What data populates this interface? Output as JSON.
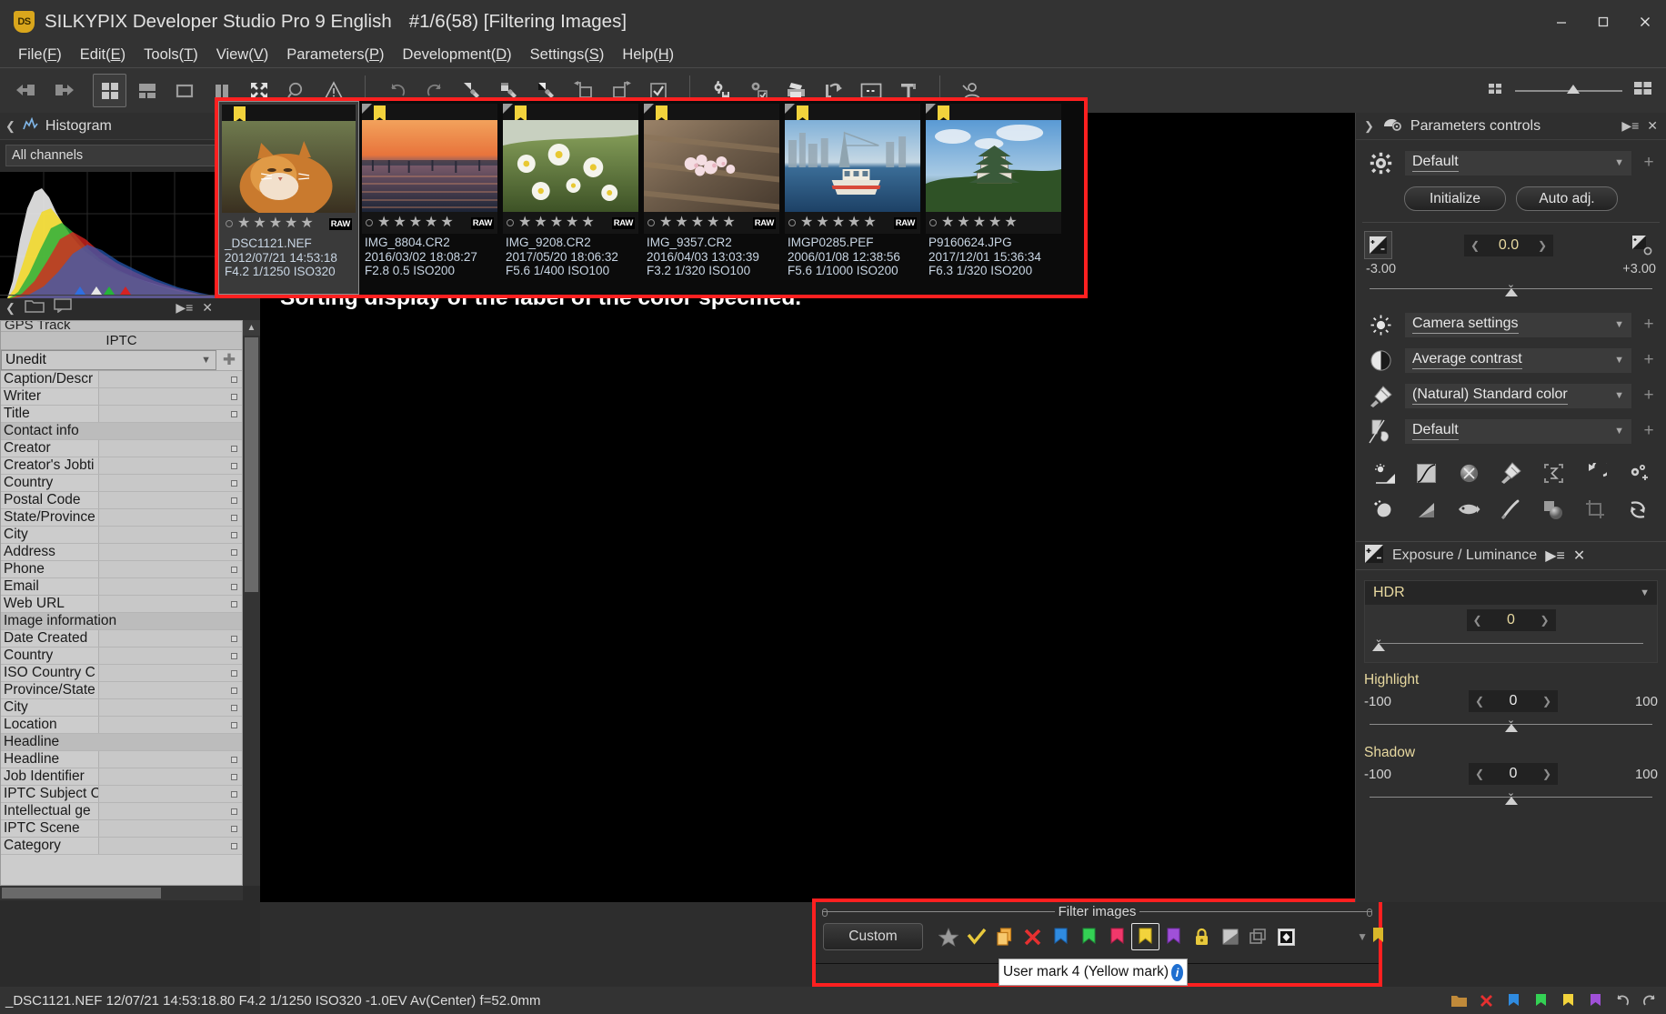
{
  "window": {
    "app_title": "SILKYPIX Developer Studio Pro 9 English",
    "doc_status": "#1/6(58) [Filtering Images]",
    "logo_text": "DS",
    "minimize": "minimize-icon",
    "maximize": "maximize-icon",
    "close": "close-icon"
  },
  "menubar": [
    {
      "label": "File(F)",
      "text": "File(",
      "key": "F",
      "tail": ")"
    },
    {
      "label": "Edit(E)",
      "text": "Edit(",
      "key": "E",
      "tail": ")"
    },
    {
      "label": "Tools(T)",
      "text": "Tools(",
      "key": "T",
      "tail": ")"
    },
    {
      "label": "View(V)",
      "text": "View(",
      "key": "V",
      "tail": ")"
    },
    {
      "label": "Parameters(P)",
      "text": "Parameters(",
      "key": "P",
      "tail": ")"
    },
    {
      "label": "Development(D)",
      "text": "Development(",
      "key": "D",
      "tail": ")"
    },
    {
      "label": "Settings(S)",
      "text": "Settings(",
      "key": "S",
      "tail": ")"
    },
    {
      "label": "Help(H)",
      "text": "Help(",
      "key": "H",
      "tail": ")"
    }
  ],
  "toolbar": {
    "group1": [
      {
        "name": "previous-image-icon"
      },
      {
        "name": "next-image-icon"
      }
    ],
    "group2": [
      {
        "name": "thumbnail-grid-view-icon",
        "selected": true
      },
      {
        "name": "combination-view-icon",
        "selected": false
      },
      {
        "name": "single-image-view-icon",
        "selected": false
      },
      {
        "name": "two-pane-view-icon",
        "selected": false
      },
      {
        "name": "fit-to-screen-icon",
        "selected": false
      },
      {
        "name": "magnifier-icon",
        "selected": false
      },
      {
        "name": "warning-icon",
        "selected": false
      }
    ],
    "group3": [
      {
        "name": "undo-icon"
      },
      {
        "name": "redo-icon"
      },
      {
        "name": "white-balance-picker-icon"
      },
      {
        "name": "gray-balance-picker-icon"
      },
      {
        "name": "black-white-point-picker-icon"
      },
      {
        "name": "rotate-left-icon"
      },
      {
        "name": "rotate-right-icon"
      },
      {
        "name": "checkmark-box-icon"
      }
    ],
    "group4": [
      {
        "name": "develop-settings-icon"
      },
      {
        "name": "batch-develop-icon"
      },
      {
        "name": "print-icon"
      },
      {
        "name": "export-icon"
      },
      {
        "name": "slideshow-icon"
      },
      {
        "name": "ruler-icon"
      }
    ],
    "group5": [
      {
        "name": "user-profile-icon"
      }
    ],
    "zoom": {
      "small_icon": "small-thumbnail-icon",
      "large_icon": "large-thumbnail-icon",
      "value_pct": 48
    }
  },
  "histogram_panel": {
    "title": "Histogram",
    "icon": "histogram-icon",
    "collapse_icon": "chevron-left-icon",
    "menu_icon": "panel-menu-icon",
    "close_icon": "close-icon",
    "channel_select": "All channels",
    "markers": [
      {
        "name": "blue-marker",
        "color": "#2f6fe0",
        "x_pct": 36
      },
      {
        "name": "white-marker",
        "color": "#e6e6e6",
        "x_pct": 45
      },
      {
        "name": "green-marker",
        "color": "#25b43a",
        "x_pct": 49
      },
      {
        "name": "red-marker",
        "color": "#d62222",
        "x_pct": 57
      }
    ],
    "tools": [
      {
        "name": "chevron-left-icon"
      },
      {
        "name": "folder-icon"
      },
      {
        "name": "comment-icon"
      },
      {
        "name": "panel-menu-icon"
      },
      {
        "name": "close-icon"
      }
    ]
  },
  "iptc_panel": {
    "clipped_top_label": "GPS Track",
    "title": "IPTC",
    "preset": "Unedit",
    "add_icon": "add-preset-icon",
    "rows": [
      {
        "label": "Caption/Descr",
        "value": "",
        "group": false
      },
      {
        "label": "Writer",
        "value": "",
        "group": false
      },
      {
        "label": "Title",
        "value": "",
        "group": false
      },
      {
        "label": "Contact info",
        "value": "",
        "group": true
      },
      {
        "label": "Creator",
        "value": "",
        "group": false
      },
      {
        "label": "Creator's Jobti",
        "value": "",
        "group": false
      },
      {
        "label": "Country",
        "value": "",
        "group": false
      },
      {
        "label": "Postal Code",
        "value": "",
        "group": false
      },
      {
        "label": "State/Province",
        "value": "",
        "group": false
      },
      {
        "label": "City",
        "value": "",
        "group": false
      },
      {
        "label": "Address",
        "value": "",
        "group": false
      },
      {
        "label": "Phone",
        "value": "",
        "group": false
      },
      {
        "label": "Email",
        "value": "",
        "group": false
      },
      {
        "label": "Web URL",
        "value": "",
        "group": false
      },
      {
        "label": "Image information",
        "value": "",
        "group": true
      },
      {
        "label": "Date Created",
        "value": "",
        "group": false
      },
      {
        "label": "Country",
        "value": "",
        "group": false
      },
      {
        "label": "ISO Country C",
        "value": "",
        "group": false
      },
      {
        "label": "Province/State",
        "value": "",
        "group": false
      },
      {
        "label": "City",
        "value": "",
        "group": false
      },
      {
        "label": "Location",
        "value": "",
        "group": false
      },
      {
        "label": "Headline",
        "value": "",
        "group": true
      },
      {
        "label": "Headline",
        "value": "",
        "group": false
      },
      {
        "label": "Job Identifier",
        "value": "",
        "group": false
      },
      {
        "label": "IPTC Subject C",
        "value": "",
        "group": false
      },
      {
        "label": "Intellectual ge",
        "value": "",
        "group": false
      },
      {
        "label": "IPTC Scene",
        "value": "",
        "group": false
      },
      {
        "label": "Category",
        "value": "",
        "group": false
      }
    ]
  },
  "filmstrip": {
    "highlight_color": "#ff2020",
    "thumbnails": [
      {
        "filename": "_DSC1121.NEF",
        "datetime": "2012/07/21 14:53:18",
        "exposure": "F4.2 1/1250 ISO320",
        "stars": 5,
        "format_badge": "RAW",
        "mark_color": "#f2d33c",
        "selected": true,
        "image": "cat-photo"
      },
      {
        "filename": "IMG_8804.CR2",
        "datetime": "2016/03/02 18:08:27",
        "exposure": "F2.8 0.5 ISO200",
        "stars": 5,
        "format_badge": "RAW",
        "mark_color": "#f2d33c",
        "selected": false,
        "image": "sunset-pier-photo"
      },
      {
        "filename": "IMG_9208.CR2",
        "datetime": "2017/05/20 18:06:32",
        "exposure": "F5.6 1/400 ISO100",
        "stars": 5,
        "format_badge": "RAW",
        "mark_color": "#f2d33c",
        "selected": false,
        "image": "daisies-photo"
      },
      {
        "filename": "IMG_9357.CR2",
        "datetime": "2016/04/03 13:03:39",
        "exposure": "F3.2 1/320 ISO100",
        "stars": 5,
        "format_badge": "RAW",
        "mark_color": "#f2d33c",
        "selected": false,
        "image": "cherry-blossom-photo"
      },
      {
        "filename": "IMGP0285.PEF",
        "datetime": "2006/01/08 12:38:56",
        "exposure": "F5.6 1/1000 ISO200",
        "stars": 5,
        "format_badge": "RAW",
        "mark_color": "#f2d33c",
        "selected": false,
        "image": "harbor-boat-photo"
      },
      {
        "filename": "P9160624.JPG",
        "datetime": "2017/12/01 15:36:34",
        "exposure": "F6.3 1/320 ISO200",
        "stars": 5,
        "format_badge": "",
        "mark_color": "#f2d33c",
        "selected": false,
        "image": "castle-photo"
      }
    ]
  },
  "center": {
    "message": "Sorting display of the label of the color specified."
  },
  "filter_images": {
    "legend": "Filter images",
    "highlight_color": "#ff2020",
    "custom_button": "Custom",
    "icons": [
      {
        "name": "star-rating-filter-icon",
        "color": "#9a9a9a",
        "selected": false
      },
      {
        "name": "checkmark-filter-icon",
        "color": "#e8c93c",
        "selected": false
      },
      {
        "name": "copy-filter-icon",
        "color": "#e8a23c",
        "selected": false
      },
      {
        "name": "reject-filter-icon",
        "color": "#e63030",
        "selected": false
      },
      {
        "name": "user-mark-1-blue-icon",
        "color": "#2f8be0",
        "selected": false
      },
      {
        "name": "user-mark-2-green-icon",
        "color": "#34d154",
        "selected": false
      },
      {
        "name": "user-mark-3-pink-icon",
        "color": "#f0386b",
        "selected": false
      },
      {
        "name": "user-mark-4-yellow-icon",
        "color": "#f2d33c",
        "selected": true
      },
      {
        "name": "user-mark-5-purple-icon",
        "color": "#a050d8",
        "selected": false
      },
      {
        "name": "lock-filter-icon",
        "color": "#e8c93c",
        "selected": false
      },
      {
        "name": "taper-filter-icon",
        "color": "#b8b8b8",
        "selected": false
      },
      {
        "name": "duplicate-filter-icon",
        "color": "#8a8a8a",
        "selected": false
      },
      {
        "name": "contrast-filter-icon",
        "color": "#e4e4e4",
        "selected": false
      }
    ],
    "dropdown_icon": "chevron-down-icon",
    "tooltip": {
      "text": "User mark 4 (Yellow mark)",
      "info_icon": "info-icon",
      "info_color": "#1f6fd0"
    }
  },
  "parameters_panel": {
    "title": "Parameters controls",
    "icon": "parameters-controls-icon",
    "expand_icon": "chevron-right-icon",
    "menu_icon": "panel-menu-icon",
    "close_icon": "close-icon",
    "preset": {
      "icon": "gear-icon",
      "value": "Default",
      "add_icon": "plus-icon"
    },
    "initialize_button": "Initialize",
    "auto_adj_button": "Auto adj.",
    "exposure_bias": {
      "icon": "exposure-compensation-icon",
      "value": "0.0",
      "min_label": "-3.00",
      "max_label": "+3.00",
      "detail_icon": "exposure-detail-icon",
      "knob_pct": 50
    },
    "rows": [
      {
        "icon": "white-balance-sun-icon",
        "value": "Camera settings",
        "add_icon": "plus-icon"
      },
      {
        "icon": "tone-contrast-icon",
        "value": "Average contrast",
        "add_icon": "plus-icon"
      },
      {
        "icon": "color-mode-icon",
        "value": "(Natural) Standard color",
        "add_icon": "plus-icon"
      },
      {
        "icon": "sharpness-brush-icon",
        "value": "Default",
        "add_icon": "plus-icon"
      }
    ],
    "tool_grid": [
      [
        {
          "name": "exposure-luminance-tool-icon"
        },
        {
          "name": "tone-curve-tool-icon"
        },
        {
          "name": "white-balance-tool-icon"
        },
        {
          "name": "color-tool-icon"
        },
        {
          "name": "sharpness-tool-icon"
        },
        {
          "name": "rotation-tool-icon"
        },
        {
          "name": "effects-tool-icon"
        }
      ],
      [
        {
          "name": "noise-reduction-tool-icon"
        },
        {
          "name": "gradation-tool-icon"
        },
        {
          "name": "lens-aberration-tool-icon"
        },
        {
          "name": "brush-tool-icon"
        },
        {
          "name": "dodge-burn-tool-icon"
        },
        {
          "name": "crop-tool-icon"
        },
        {
          "name": "misc-tool-icon"
        }
      ]
    ]
  },
  "exposure_panel": {
    "title": "Exposure / Luminance",
    "icon": "exposure-luminance-icon",
    "menu_icon": "panel-menu-icon",
    "close_icon": "close-icon",
    "hdr": {
      "label": "HDR",
      "value": "0",
      "dropdown_icon": "chevron-down-icon",
      "knob_pct": 1
    },
    "highlight": {
      "label": "Highlight",
      "value": "0",
      "min_label": "-100",
      "max_label": "100",
      "knob_pct": 50
    },
    "shadow": {
      "label": "Shadow",
      "value": "0",
      "min_label": "-100",
      "max_label": "100",
      "knob_pct": 50
    }
  },
  "statusbar": {
    "text": "_DSC1121.NEF 12/07/21 14:53:18.80 F4.2 1/1250 ISO320 -1.0EV Av(Center) f=52.0mm",
    "icons": [
      {
        "name": "folder-status-icon",
        "color": "#c08a3a"
      },
      {
        "name": "reject-status-icon",
        "color": "#e63030"
      },
      {
        "name": "blue-mark-status-icon",
        "color": "#2f8be0"
      },
      {
        "name": "green-mark-status-icon",
        "color": "#34d154"
      },
      {
        "name": "yellow-mark-status-icon",
        "color": "#f2d33c"
      },
      {
        "name": "purple-mark-status-icon",
        "color": "#a050d8"
      },
      {
        "name": "undo-status-icon",
        "color": "#b8b8b8"
      },
      {
        "name": "redo-status-icon",
        "color": "#b8b8b8"
      }
    ]
  }
}
